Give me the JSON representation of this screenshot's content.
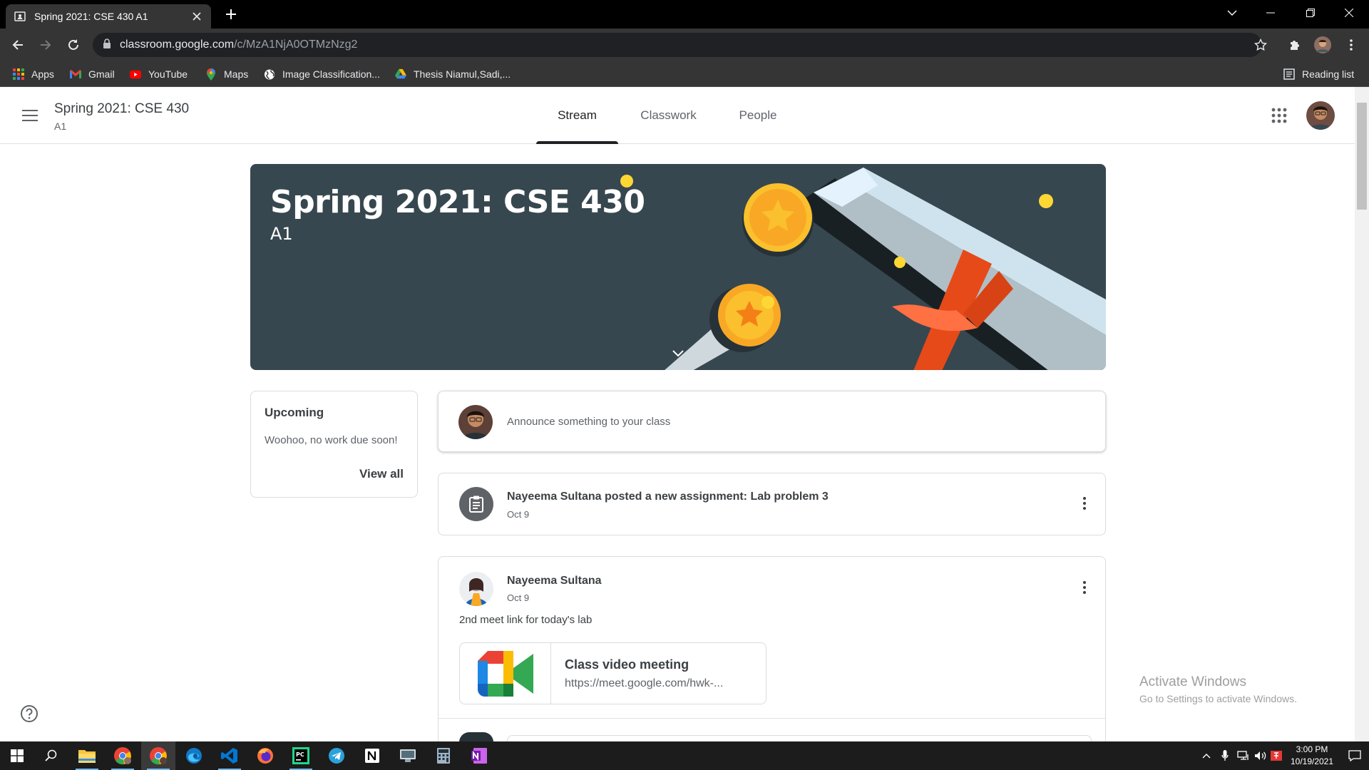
{
  "browser": {
    "tab_title": "Spring 2021: CSE 430 A1",
    "url_domain": "classroom.google.com",
    "url_path": "/c/MzA1NjA0OTMzNzg2",
    "bookmarks": [
      {
        "label": "Apps",
        "icon": "apps-grid-icon"
      },
      {
        "label": "Gmail",
        "icon": "gmail-icon"
      },
      {
        "label": "YouTube",
        "icon": "youtube-icon"
      },
      {
        "label": "Maps",
        "icon": "maps-icon"
      },
      {
        "label": "Image Classification...",
        "icon": "globe-icon"
      },
      {
        "label": "Thesis Niamul,Sadi,...",
        "icon": "drive-icon"
      }
    ],
    "reading_list": "Reading list"
  },
  "header": {
    "class_name": "Spring 2021: CSE 430",
    "section": "A1",
    "tabs": [
      {
        "label": "Stream",
        "active": true
      },
      {
        "label": "Classwork",
        "active": false
      },
      {
        "label": "People",
        "active": false
      }
    ]
  },
  "banner": {
    "title": "Spring 2021: CSE 430",
    "subtitle": "A1",
    "color": "#37474f"
  },
  "upcoming": {
    "title": "Upcoming",
    "message": "Woohoo, no work due soon!",
    "link": "View all"
  },
  "stream": {
    "announce_placeholder": "Announce something to your class",
    "assignment": {
      "text": "Nayeema Sultana posted a new assignment: Lab problem 3",
      "date": "Oct 9"
    },
    "post": {
      "author": "Nayeema Sultana",
      "date": "Oct 9",
      "body": "2nd meet link for today's lab",
      "attachment": {
        "title": "Class video meeting",
        "url": "https://meet.google.com/hwk-..."
      }
    }
  },
  "watermark": {
    "line1": "Activate Windows",
    "line2": "Go to Settings to activate Windows."
  },
  "taskbar": {
    "time": "3:00 PM",
    "date": "10/19/2021"
  }
}
